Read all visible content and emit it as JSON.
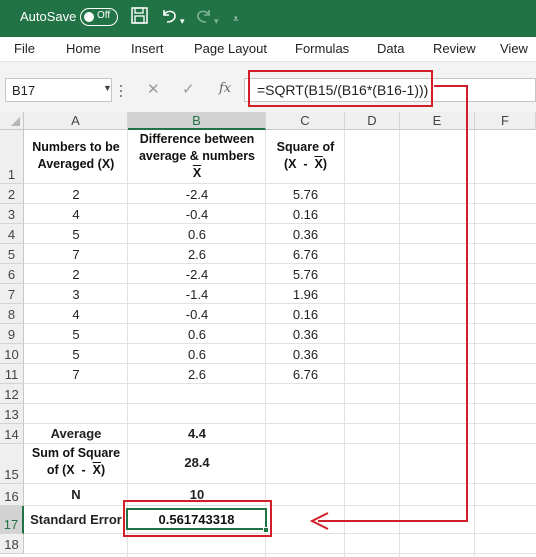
{
  "titlebar": {
    "autosave_label": "AutoSave",
    "toggle_state": "Off"
  },
  "menu": [
    "File",
    "Home",
    "Insert",
    "Page Layout",
    "Formulas",
    "Data",
    "Review",
    "View"
  ],
  "formula_bar": {
    "name_box": "B17",
    "fx_label": "fx",
    "formula": "=SQRT(B15/(B16*(B16-1)))"
  },
  "columns": [
    "A",
    "B",
    "C",
    "D",
    "E",
    "F"
  ],
  "rows": [
    "1",
    "2",
    "3",
    "4",
    "5",
    "6",
    "7",
    "8",
    "9",
    "10",
    "11",
    "12",
    "13",
    "14",
    "15",
    "16",
    "17",
    "18"
  ],
  "headers": {
    "a1_line1": "Numbers to be",
    "a1_line2": "Averaged (X)",
    "b1_line1": "Difference between",
    "b1_line2": "average & numbers",
    "b1_line3": "X",
    "c1_line1": "Square of",
    "c1_line2_pre": "(X  -  ",
    "c1_line2_bar": "X",
    "c1_line2_post": ")"
  },
  "data_rows": [
    {
      "x": "2",
      "diff": "-2.4",
      "sq": "5.76"
    },
    {
      "x": "4",
      "diff": "-0.4",
      "sq": "0.16"
    },
    {
      "x": "5",
      "diff": "0.6",
      "sq": "0.36"
    },
    {
      "x": "7",
      "diff": "2.6",
      "sq": "6.76"
    },
    {
      "x": "2",
      "diff": "-2.4",
      "sq": "5.76"
    },
    {
      "x": "3",
      "diff": "-1.4",
      "sq": "1.96"
    },
    {
      "x": "4",
      "diff": "-0.4",
      "sq": "0.16"
    },
    {
      "x": "5",
      "diff": "0.6",
      "sq": "0.36"
    },
    {
      "x": "5",
      "diff": "0.6",
      "sq": "0.36"
    },
    {
      "x": "7",
      "diff": "2.6",
      "sq": "6.76"
    }
  ],
  "summary": {
    "average_label": "Average",
    "average_value": "4.4",
    "sum_label_line1": "Sum of Square",
    "sum_label_line2_pre": "of (X  -  ",
    "sum_label_line2_bar": "X",
    "sum_label_line2_post": ")",
    "sum_value": "28.4",
    "n_label": "N",
    "n_value": "10",
    "se_label": "Standard Error",
    "se_value": "0.561743318"
  },
  "colors": {
    "excel_green": "#217346",
    "highlight_red": "#d11f2a"
  }
}
